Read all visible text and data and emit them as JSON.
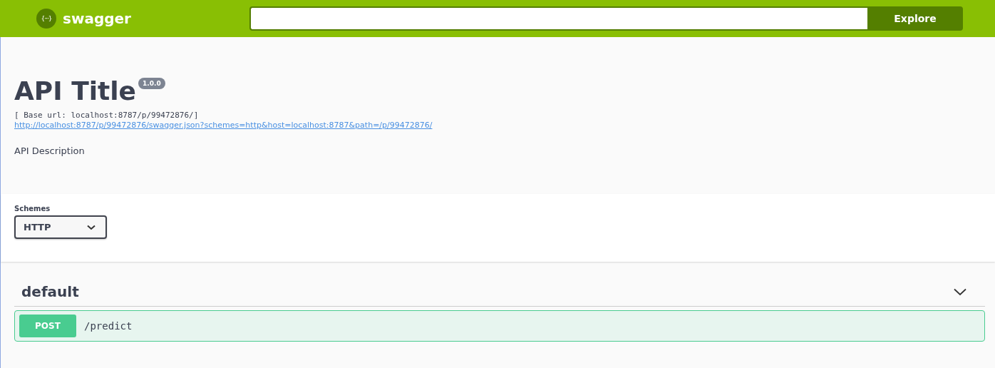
{
  "topbar": {
    "logo_mark": "{···}",
    "logo_text": "swagger",
    "explore_button": "Explore"
  },
  "info": {
    "title": "API Title",
    "version": "1.0.0",
    "base_url": "[ Base url: localhost:8787/p/99472876/]",
    "spec_link": "http://localhost:8787/p/99472876/swagger.json?schemes=http&host=localhost:8787&path=/p/99472876/",
    "description": "API Description"
  },
  "schemes": {
    "label": "Schemes",
    "value": "HTTP"
  },
  "tags": [
    {
      "name": "default",
      "expanded": true,
      "operations": [
        {
          "method": "POST",
          "kind": "post",
          "path": "/predict"
        }
      ]
    }
  ]
}
